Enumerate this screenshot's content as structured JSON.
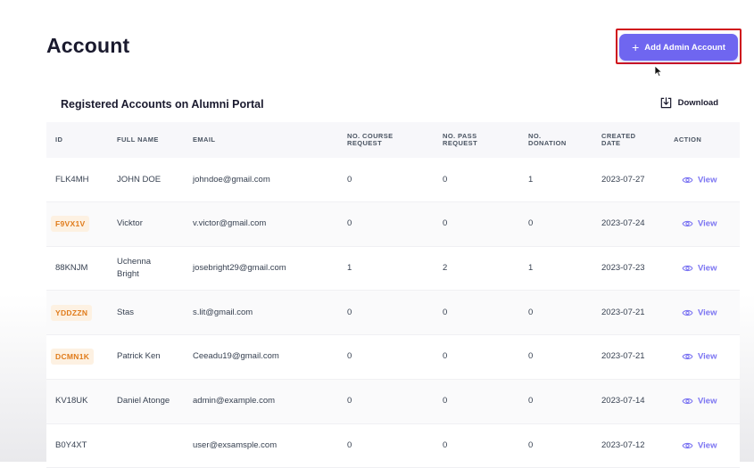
{
  "page": {
    "title": "Account"
  },
  "actions": {
    "add_admin_label": "Add Admin Account"
  },
  "card": {
    "title": "Registered Accounts on Alumni Portal",
    "download_label": "Download"
  },
  "table": {
    "headers": {
      "id": "ID",
      "full_name": "FULL NAME",
      "email": "EMAIL",
      "course_request": "NO. COURSE\nREQUEST",
      "pass_request": "NO. PASS\nREQUEST",
      "donation": "NO.\nDONATION",
      "created_date": "CREATED\nDATE",
      "action": "ACTION"
    },
    "view_label": "View",
    "rows": [
      {
        "id": "FLK4MH",
        "name": "JOHN DOE",
        "email": "johndoe@gmail.com",
        "course": "0",
        "pass": "0",
        "donation": "1",
        "date": "2023-07-27",
        "badge": false
      },
      {
        "id": "F9VX1V",
        "name": "Vicktor",
        "email": "v.victor@gmail.com",
        "course": "0",
        "pass": "0",
        "donation": "0",
        "date": "2023-07-24",
        "badge": true
      },
      {
        "id": "88KNJM",
        "name": "Uchenna\nBright",
        "email": "josebright29@gmail.com",
        "course": "1",
        "pass": "2",
        "donation": "1",
        "date": "2023-07-23",
        "badge": false
      },
      {
        "id": "YDDZZN",
        "name": "Stas",
        "email": "s.lit@gmail.com",
        "course": "0",
        "pass": "0",
        "donation": "0",
        "date": "2023-07-21",
        "badge": true
      },
      {
        "id": "DCMN1K",
        "name": "Patrick Ken",
        "email": "Ceeadu19@gmail.com",
        "course": "0",
        "pass": "0",
        "donation": "0",
        "date": "2023-07-21",
        "badge": true
      },
      {
        "id": "KV18UK",
        "name": "Daniel Atonge",
        "email": "admin@example.com",
        "course": "0",
        "pass": "0",
        "donation": "0",
        "date": "2023-07-14",
        "badge": false
      },
      {
        "id": "B0Y4XT",
        "name": "",
        "email": "user@exsamsple.com",
        "course": "0",
        "pass": "0",
        "donation": "0",
        "date": "2023-07-12",
        "badge": false
      }
    ]
  },
  "colors": {
    "accent": "#6f66f0",
    "link": "#7b74f2",
    "badge_text": "#e07b1a",
    "badge_bg": "#fdf1e2",
    "highlight": "#d0121b"
  },
  "icons": {
    "add": "plus-icon",
    "download": "download-icon",
    "view": "eye-icon",
    "cursor": "mouse-cursor-icon"
  }
}
